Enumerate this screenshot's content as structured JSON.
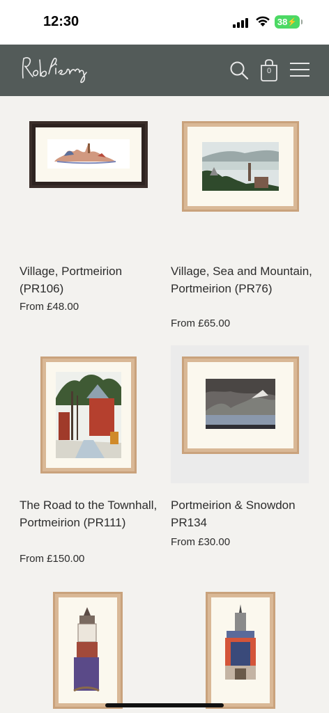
{
  "status_bar": {
    "time": "12:30",
    "battery": "38"
  },
  "header": {
    "logo_text": "RobPiercy",
    "cart_count": "0"
  },
  "products": [
    {
      "title": "Village, Portmeirion (PR106)",
      "price": "From £48.00"
    },
    {
      "title": "Village, Sea and Mountain, Portmeirion (PR76)",
      "price": "From £65.00"
    },
    {
      "title": "The Road to the Townhall, Portmeirion (PR111)",
      "price": "From £150.00"
    },
    {
      "title": "Portmeirion & Snowdon PR134",
      "price": "From £30.00"
    },
    {
      "title": "",
      "price": ""
    },
    {
      "title": "",
      "price": ""
    }
  ],
  "icons": {
    "search": "search-icon",
    "cart": "shopping-bag-icon",
    "menu": "hamburger-menu-icon"
  },
  "colors": {
    "header_bg": "#535b59",
    "page_bg": "#f3f2ef",
    "dark_frame": "#3a2e2a",
    "oak_frame": "#c9a27c",
    "battery": "#4cd964"
  }
}
